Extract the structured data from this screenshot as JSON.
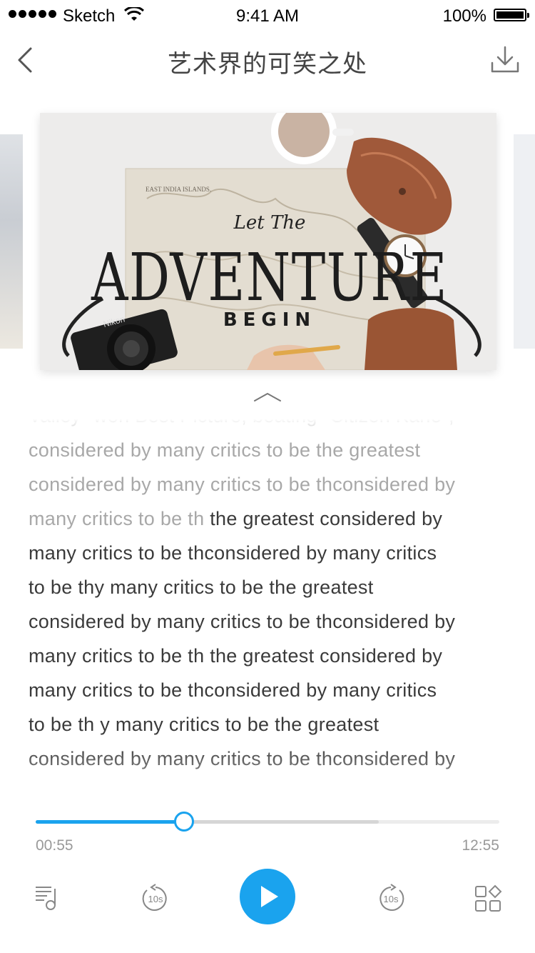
{
  "status_bar": {
    "carrier": "Sketch",
    "time": "9:41 AM",
    "battery": "100%"
  },
  "nav": {
    "title": "艺术界的可笑之处",
    "back_icon": "chevron-left-icon",
    "download_icon": "download-icon"
  },
  "cover": {
    "line1": "Let The",
    "line2": "ADVENTURE",
    "line3": "BEGIN",
    "map_label": "EAST INDIA ISLANDS.",
    "camera_brand": "Nikon"
  },
  "reader": {
    "lines": [
      {
        "dim": "Valley\" won Best Picture, beating \"Citizen Kane\",",
        "normal": ""
      },
      {
        "dim": "considered by many critics to be the greatest",
        "normal": ""
      },
      {
        "dim": "considered by many critics to be thconsidered by",
        "normal": ""
      },
      {
        "dim": "many critics to be th ",
        "normal": "the greatest considered by"
      },
      {
        "dim": "",
        "normal": "many critics to be thconsidered by many critics"
      },
      {
        "dim": "",
        "normal": "to be thy many critics to be the greatest"
      },
      {
        "dim": "",
        "normal": "considered by many critics to be thconsidered by"
      },
      {
        "dim": "",
        "normal": "many critics to be th the greatest considered by"
      },
      {
        "dim": "",
        "normal": "many critics to be thconsidered by many critics"
      },
      {
        "dim": "",
        "normal": "to be th y many critics to be the greatest"
      },
      {
        "dim": "",
        "normal": "considered by many critics to be thconsidered by"
      }
    ]
  },
  "player": {
    "current_time": "00:55",
    "total_time": "12:55",
    "progress": 0.32,
    "buffered": 0.74,
    "accent_color": "#1aa3ee",
    "rewind_label": "10s",
    "forward_label": "10s",
    "icons": {
      "playlist": "playlist-icon",
      "rewind": "rewind-10s-icon",
      "play": "play-icon",
      "forward": "forward-10s-icon",
      "more": "apps-grid-icon"
    }
  }
}
